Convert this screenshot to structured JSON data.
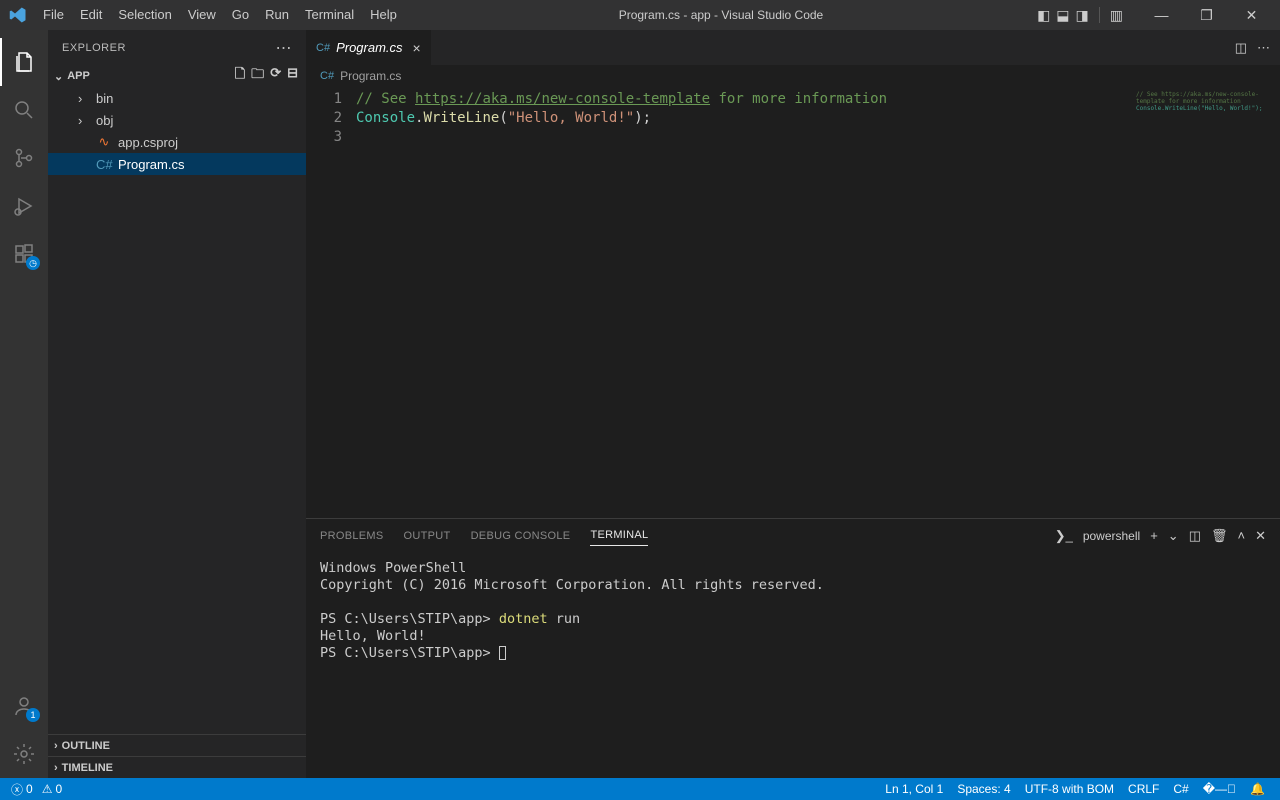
{
  "window": {
    "title": "Program.cs - app - Visual Studio Code"
  },
  "menu": [
    "File",
    "Edit",
    "Selection",
    "View",
    "Go",
    "Run",
    "Terminal",
    "Help"
  ],
  "explorer": {
    "title": "EXPLORER",
    "root": "APP",
    "items": {
      "bin": "bin",
      "obj": "obj",
      "csproj": "app.csproj",
      "program": "Program.cs"
    },
    "outline": "OUTLINE",
    "timeline": "TIMELINE"
  },
  "tabs": {
    "program": "Program.cs"
  },
  "breadcrumb": {
    "file": "Program.cs"
  },
  "code": {
    "l1_comment": "// See ",
    "l1_url": "https://aka.ms/new-console-template",
    "l1_rest": " for more information",
    "l2_class": "Console",
    "l2_dot": ".",
    "l2_method": "WriteLine",
    "l2_open": "(",
    "l2_str": "\"Hello, World!\"",
    "l2_close": ");",
    "line_nums": {
      "n1": "1",
      "n2": "2",
      "n3": "3"
    }
  },
  "panel": {
    "tabs": {
      "problems": "PROBLEMS",
      "output": "OUTPUT",
      "debug": "DEBUG CONSOLE",
      "terminal": "TERMINAL"
    },
    "shell_label": "powershell",
    "term": {
      "l1": "Windows PowerShell",
      "l2": "Copyright (C) 2016 Microsoft Corporation. All rights reserved.",
      "l3": "",
      "l4_prompt": "PS C:\\Users\\STIP\\app> ",
      "l4_cmd": "dotnet",
      "l4_arg": " run",
      "l5": "Hello, World!",
      "l6": "PS C:\\Users\\STIP\\app> "
    }
  },
  "status": {
    "errors": "0",
    "warnings": "0",
    "ln_col": "Ln 1, Col 1",
    "spaces": "Spaces: 4",
    "encoding": "UTF-8 with BOM",
    "eol": "CRLF",
    "lang": "C#",
    "feedback": "",
    "bell": ""
  },
  "activity": {
    "account_badge": "1"
  }
}
